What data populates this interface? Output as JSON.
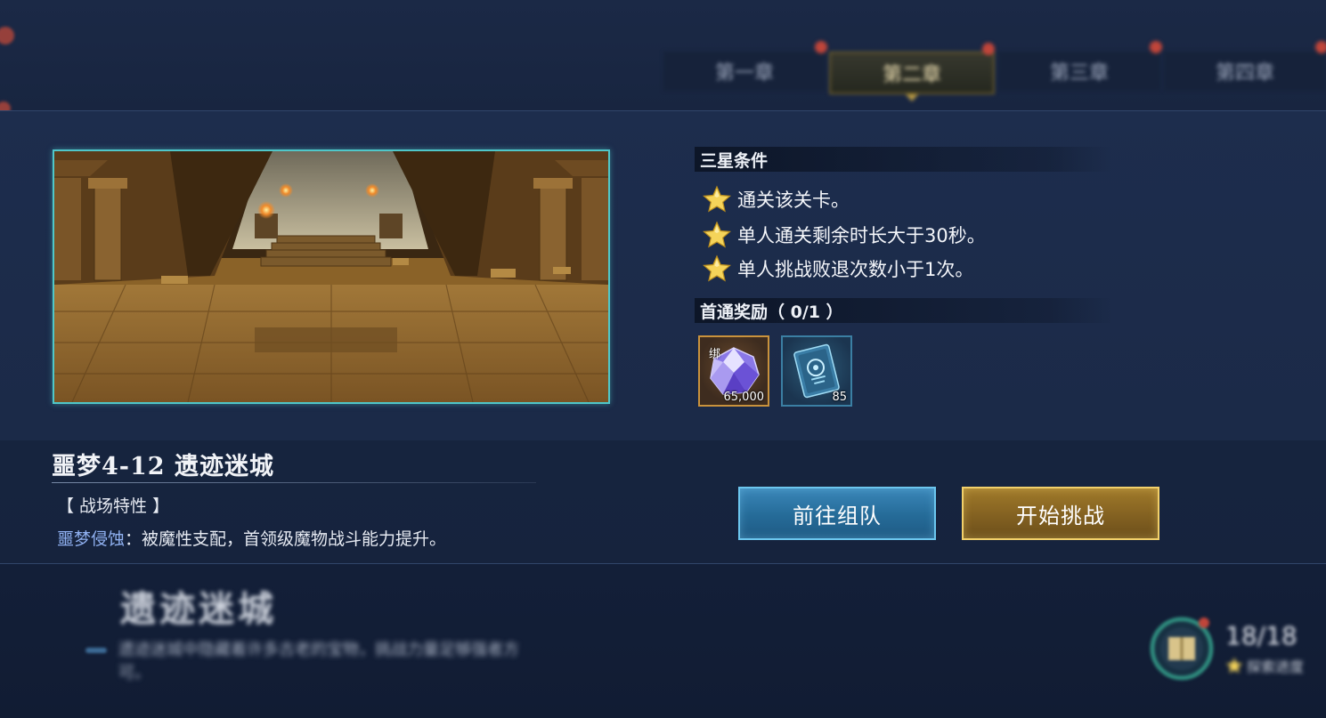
{
  "chapters": {
    "tabs": [
      {
        "label": "第一章",
        "active": false
      },
      {
        "label": "第二章",
        "active": true
      },
      {
        "label": "第三章",
        "active": false
      },
      {
        "label": "第四章",
        "active": false
      }
    ]
  },
  "stage": {
    "title": "噩梦4-12  遗迹迷城",
    "feature_header": "【 战场特性 】",
    "feature_name": "噩梦侵蚀",
    "feature_desc": "：被魔性支配，首领级魔物战斗能力提升。"
  },
  "three_star": {
    "header": "三星条件",
    "conditions": [
      "通关该关卡。",
      "单人通关剩余时长大于30秒。",
      "单人挑战败退次数小于1次。"
    ]
  },
  "first_clear": {
    "header": "首通奖励（ 0/1 ）",
    "rewards": [
      {
        "tag": "绑",
        "quantity": "65,000",
        "icon": "crystal-gem-icon",
        "frame_color": "#c9923c"
      },
      {
        "tag": "",
        "quantity": "85",
        "icon": "blueprint-card-icon",
        "frame_color": "#3b7fa3"
      }
    ]
  },
  "buttons": {
    "team_label": "前往组队",
    "start_label": "开始挑战"
  },
  "background": {
    "zone_title": "遗迹迷城",
    "zone_desc": "遗迹迷城中隐藏着许多古老的宝物，挑战力量足够强者方可。",
    "progress": "18/18",
    "progress_sub": "探索进度"
  },
  "colors": {
    "accent_teal": "#4fc7c9",
    "star_gold": "#f5d45a",
    "feature_blue": "#8fb0f0",
    "team_button": "#2a73a3",
    "start_button": "#8a6524"
  }
}
